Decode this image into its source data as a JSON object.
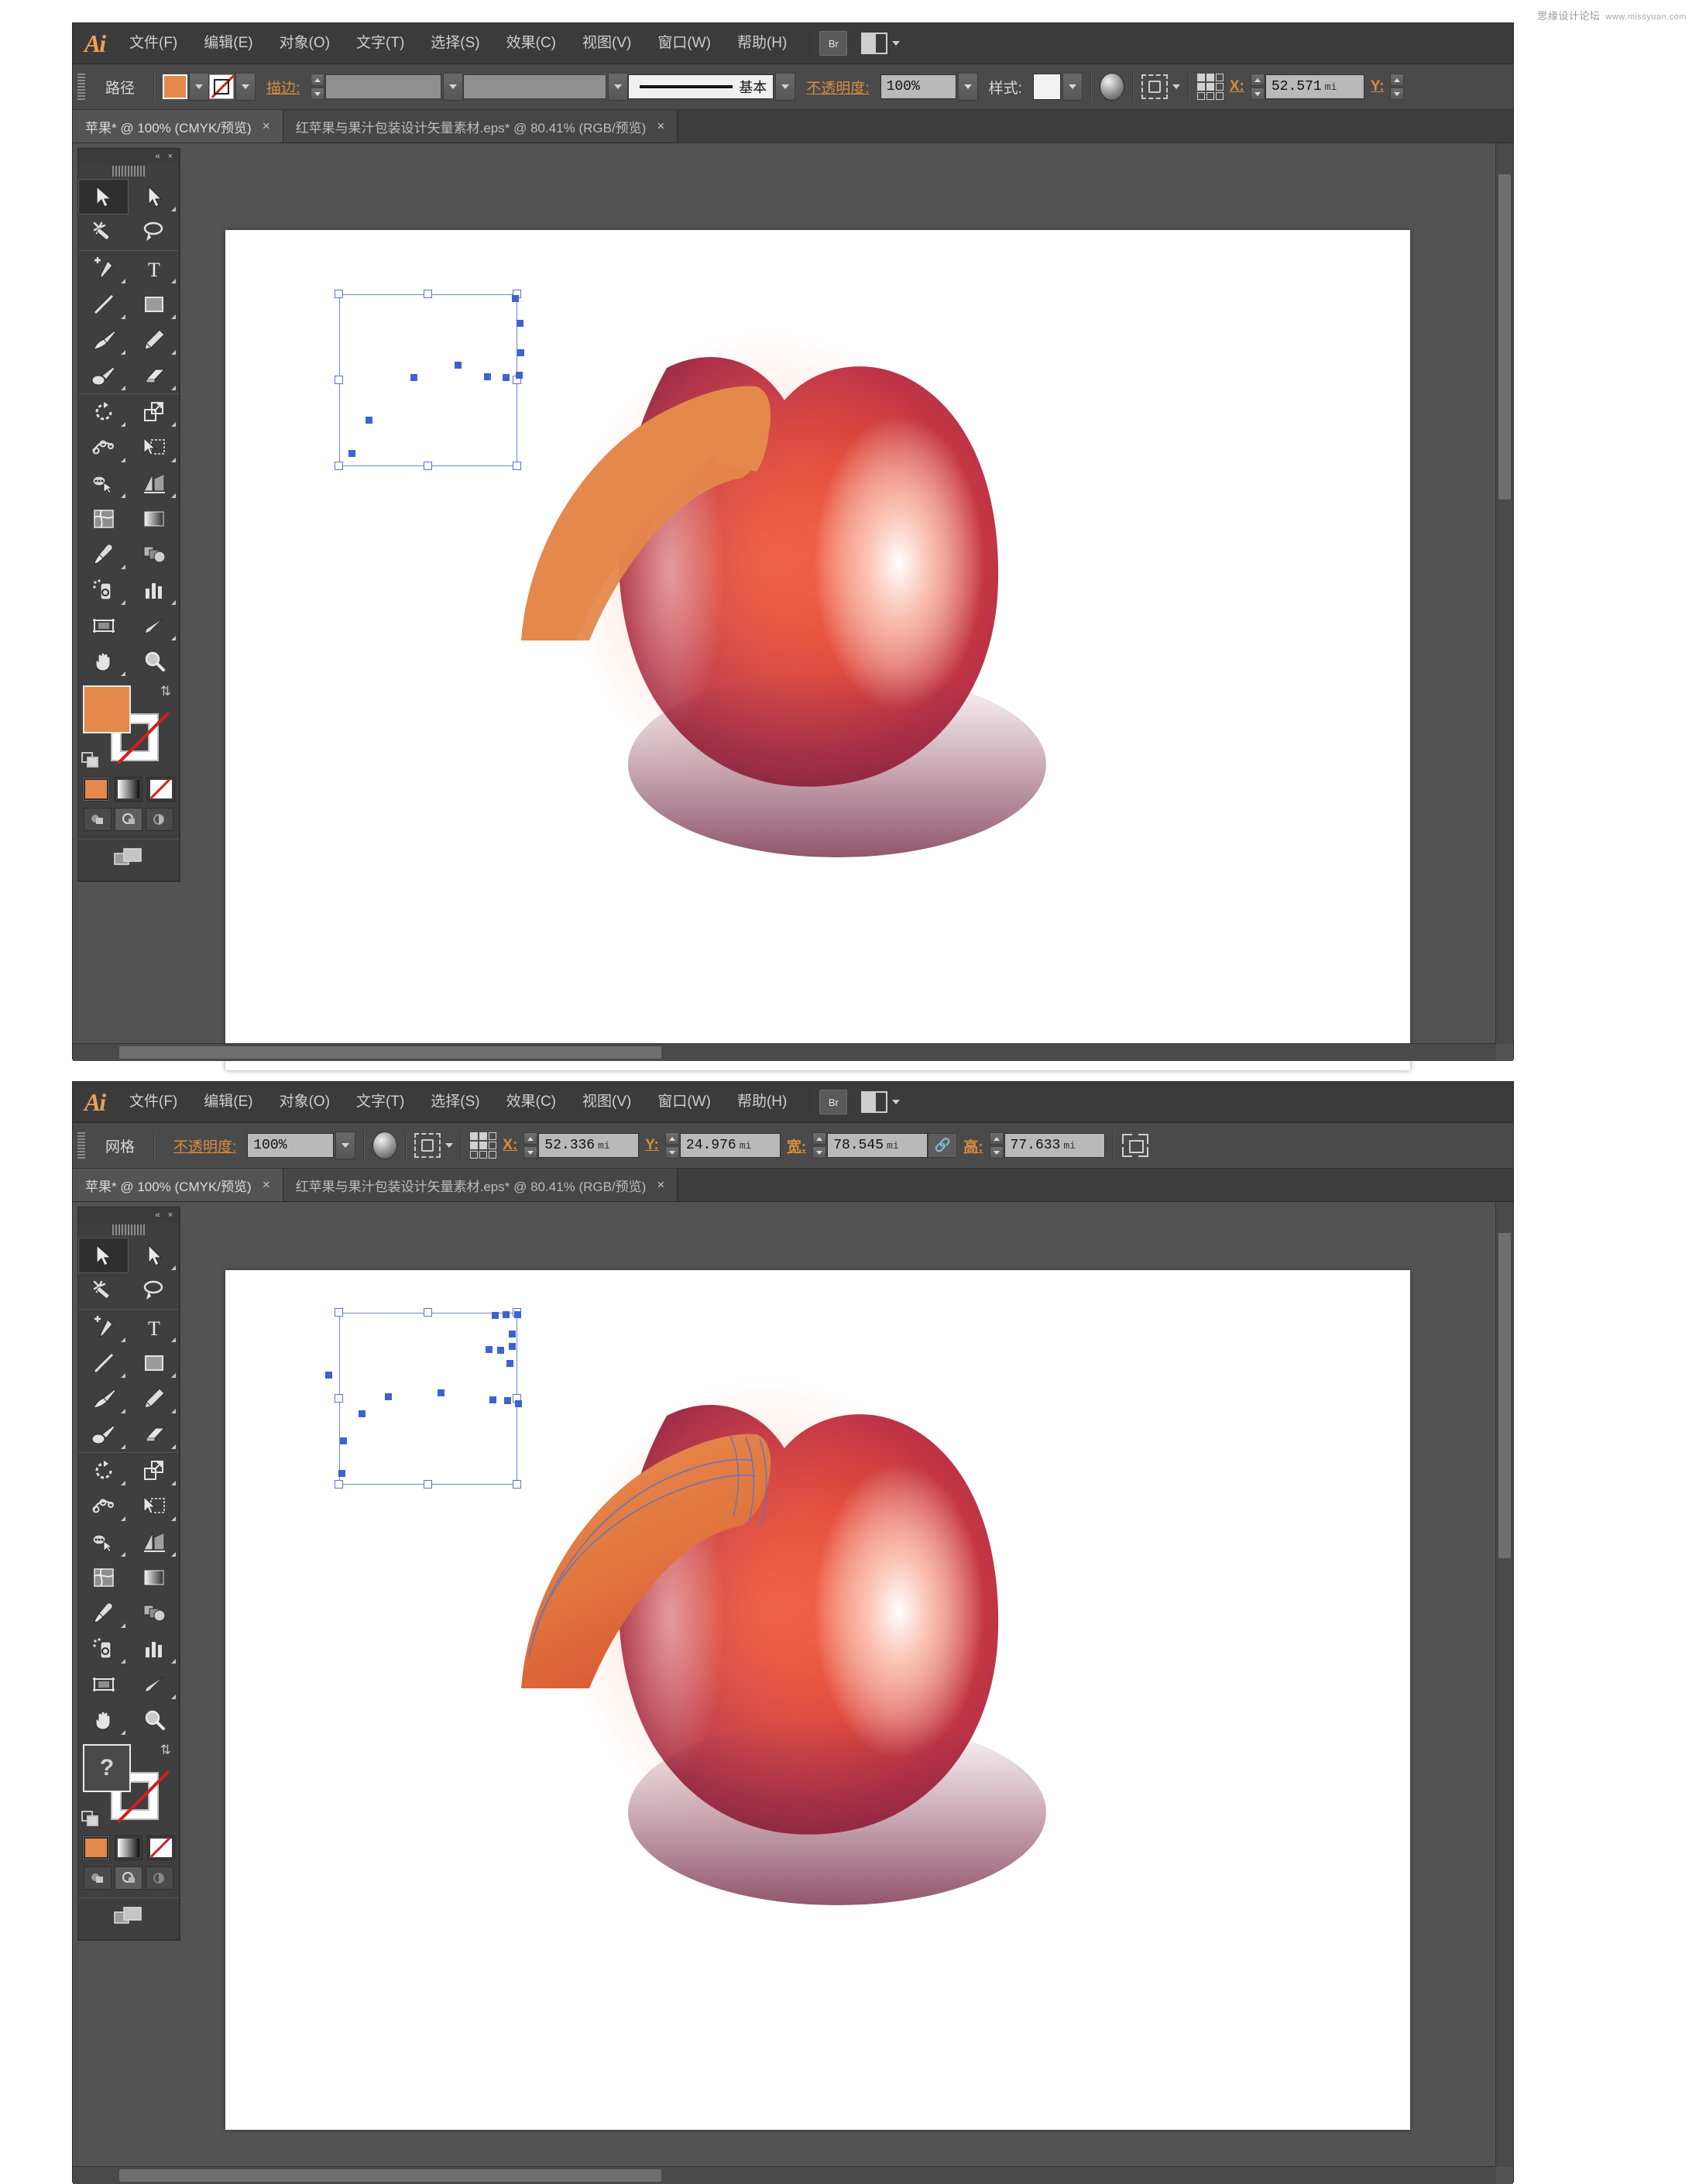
{
  "watermark": {
    "text": "思缘设计论坛",
    "url": "www.missyuan.com"
  },
  "menu": {
    "logo": "Ai",
    "items": [
      "文件(F)",
      "编辑(E)",
      "对象(O)",
      "文字(T)",
      "选择(S)",
      "效果(C)",
      "视图(V)",
      "窗口(W)",
      "帮助(H)"
    ],
    "bridge_label": "Br",
    "arrange_label": "排列文档"
  },
  "window_top": {
    "control_bar": {
      "context_label": "路径",
      "fill_color": "#e4884c",
      "stroke_label": "描边:",
      "stroke_weight": "",
      "stroke_profile": "",
      "brush_label": "基本",
      "opacity_label": "不透明度:",
      "opacity_value": "100%",
      "style_label": "样式:",
      "x_label": "X:",
      "x_value": "52.571",
      "x_unit": "mi",
      "y_label": "Y:",
      "y_value": "",
      "y_unit": ""
    },
    "tabs": [
      {
        "title": "苹果* @ 100% (CMYK/预览)",
        "active": true,
        "close": "×"
      },
      {
        "title": "红苹果与果汁包装设计矢量素材.eps* @ 80.41% (RGB/预览)",
        "active": false,
        "close": "×"
      }
    ],
    "tools": {
      "collapse": "«",
      "close": "×",
      "fill_color": "#e4884c",
      "stroke_color": "#ffffff",
      "stroke_is_none": true,
      "fill_is_unknown": false,
      "items": [
        "selection-tool",
        "direct-selection-tool",
        "magic-wand-tool",
        "lasso-tool",
        "pen-tool",
        "type-tool",
        "line-segment-tool",
        "rectangle-tool",
        "paintbrush-tool",
        "pencil-tool",
        "blob-brush-tool",
        "eraser-tool",
        "rotate-tool",
        "scale-tool",
        "width-tool",
        "free-transform-tool",
        "shape-builder-tool",
        "perspective-grid-tool",
        "mesh-tool",
        "gradient-tool",
        "eyedropper-tool",
        "blend-tool",
        "symbol-sprayer-tool",
        "column-graph-tool",
        "artboard-tool",
        "slice-tool",
        "hand-tool",
        "zoom-tool"
      ]
    },
    "artwork": {
      "name": "red-apple-with-orange-highlight-path",
      "selection": "path"
    }
  },
  "window_bottom": {
    "control_bar": {
      "context_label": "网格",
      "opacity_label": "不透明度:",
      "opacity_value": "100%",
      "x_label": "X:",
      "x_value": "52.336",
      "x_unit": "mi",
      "y_label": "Y:",
      "y_value": "24.976",
      "y_unit": "mi",
      "w_label": "宽:",
      "w_value": "78.545",
      "w_unit": "mi",
      "h_label": "高:",
      "h_value": "77.633",
      "h_unit": "mi",
      "link_label": "链接宽高比"
    },
    "tabs": [
      {
        "title": "苹果* @ 100% (CMYK/预览)",
        "active": true,
        "close": "×"
      },
      {
        "title": "红苹果与果汁包装设计矢量素材.eps* @ 80.41% (RGB/预览)",
        "active": false,
        "close": "×"
      }
    ],
    "tools": {
      "collapse": "«",
      "close": "×",
      "fill_color": "#4a4a4a",
      "fill_unknown_glyph": "?",
      "stroke_color": "#ffffff",
      "stroke_is_none": true,
      "fill_is_unknown": true
    },
    "artwork": {
      "name": "red-apple-with-gradient-mesh",
      "selection": "mesh"
    }
  },
  "colors": {
    "accent_orange": "#d98c3f",
    "fill_orange": "#e4884c",
    "selection_blue": "#5575c8",
    "anchor_blue": "#3e62cf",
    "panel_bg": "#3f3f3f",
    "workspace_bg": "#535353"
  }
}
